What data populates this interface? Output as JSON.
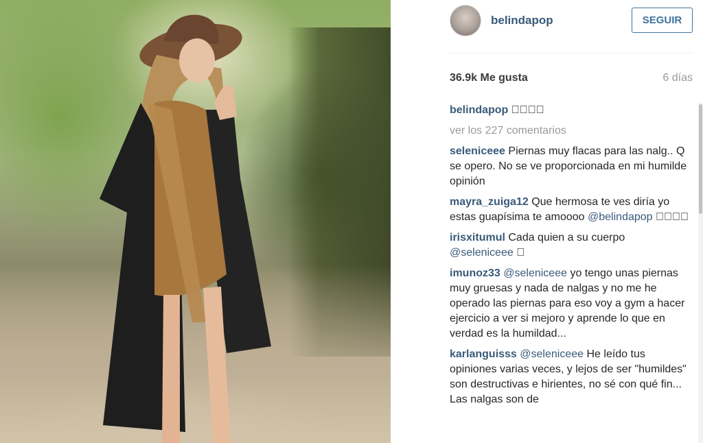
{
  "post": {
    "username": "belindapop",
    "follow_label": "SEGUIR",
    "likes": "36.9k Me gusta",
    "time": "6 días",
    "caption": "􀀀􀀀􀀀􀀀",
    "view_all": "ver los 227 comentarios"
  },
  "comments": [
    {
      "user": "seleniceee",
      "text": "Piernas muy flacas para las nalg.. Q se opero. No se ve proporcionada en mi humilde opinión"
    },
    {
      "user": "mayra_zuiga12",
      "text": "Que hermosa te ves diría yo estas guapísima te amoooo",
      "mention": "@belindapop",
      "after": "􀀀􀀀􀀀􀀀"
    },
    {
      "user": "irisxitumul",
      "text": "Cada quien a su cuerpo",
      "mention": "@seleniceee",
      "after": "􀀀"
    },
    {
      "user": "imunoz33",
      "mention": "@seleniceee",
      "text": "yo tengo unas piernas muy gruesas y nada de nalgas y no me he operado las piernas para eso voy a gym a hacer ejercicio a ver si mejoro y aprende lo que en verdad es la humildad..."
    },
    {
      "user": "karlanguisss",
      "mention": "@seleniceee",
      "text": "He leído tus opiniones varias veces, y lejos de ser \"humildes\" son destructivas e hirientes, no sé con qué fin... Las nalgas son de"
    }
  ]
}
